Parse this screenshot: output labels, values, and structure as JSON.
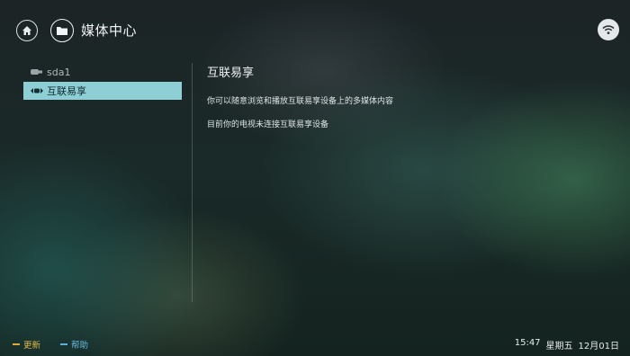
{
  "header": {
    "title": "媒体中心",
    "home_icon": "home-icon",
    "app_icon": "folder-icon",
    "wifi_icon": "wifi-icon"
  },
  "sidebar": {
    "items": [
      {
        "label": "sda1",
        "icon": "usb-drive-icon",
        "active": false
      },
      {
        "label": "互联易享",
        "icon": "dlna-icon",
        "active": true
      }
    ]
  },
  "detail": {
    "title": "互联易享",
    "line1": "你可以随意浏览和播放互联易享设备上的多媒体内容",
    "line2": "目前你的电视未连接互联易享设备"
  },
  "footer": {
    "update_label": "更新",
    "help_label": "帮助",
    "time": "15:47",
    "weekday": "星期五",
    "date": "12月01日"
  },
  "colors": {
    "active_item": "#8ecfd5",
    "update_accent": "#e3a83a",
    "help_accent": "#5aaee0"
  }
}
